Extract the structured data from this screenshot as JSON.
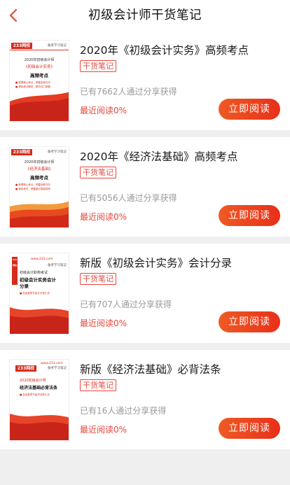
{
  "header": {
    "title": "初级会计师干货笔记",
    "back_icon": "chevron-left-icon",
    "accent": "#e8453c"
  },
  "list": [
    {
      "title": "2020年《初级会计实务》高频考点",
      "tag": "干货笔记",
      "shared": "已有7662人通过分享获得",
      "recent": "最近阅读0%",
      "button": "立即阅读",
      "cover": {
        "logo": "233网校",
        "brand": "备考学习笔记",
        "line1": "2020年初级会计师",
        "line2": "《初级会计实务》",
        "line3": "高频考点",
        "bullet1": "■ 梳理核心考点，掌握全新方向",
        "bullet2": "■ 紧扣考试教材，精华试门考题"
      }
    },
    {
      "title": "2020年《经济法基础》高频考点",
      "tag": "干货笔记",
      "shared": "已有5056人通过分享获得",
      "recent": "最近阅读0%",
      "button": "立即阅读",
      "cover": {
        "logo": "233网校",
        "brand": "备考学习笔记",
        "line1": "2020年初级会计师",
        "line2": "《经济法基础》",
        "line3": "高频考点",
        "bullet1": "■ 梳理核心考点，掌握全新方向",
        "bullet2": "■ 紧扣考试，把握重点提高效率"
      }
    },
    {
      "title": "新版《初级会计实务》会计分录",
      "tag": "干货笔记",
      "shared": "已有707人通过分享获得",
      "recent": "最近阅读0%",
      "button": "立即阅读",
      "cover": {
        "logo": "233网校",
        "brand": "备考学习笔记",
        "site": "www.233.com",
        "line1": "初级会计职称考试",
        "line2": "",
        "line3": "初级会计实务会计分录",
        "bullet1": "■ 包含各章节会计分录汇总",
        "bullet2": ""
      }
    },
    {
      "title": "新版《经济法基础》必背法条",
      "tag": "干货笔记",
      "shared": "已有16人通过分享获得",
      "recent": "最近阅读0%",
      "button": "立即阅读",
      "cover": {
        "logo": "233网校",
        "brand": "备考学习笔记",
        "site": "www.233.com",
        "line1": "2020初级会计师",
        "line2": "",
        "line3": "经济法基础必背法条",
        "bullet1": "■ 包含各章节经济法条汇总",
        "bullet2": ""
      }
    }
  ]
}
